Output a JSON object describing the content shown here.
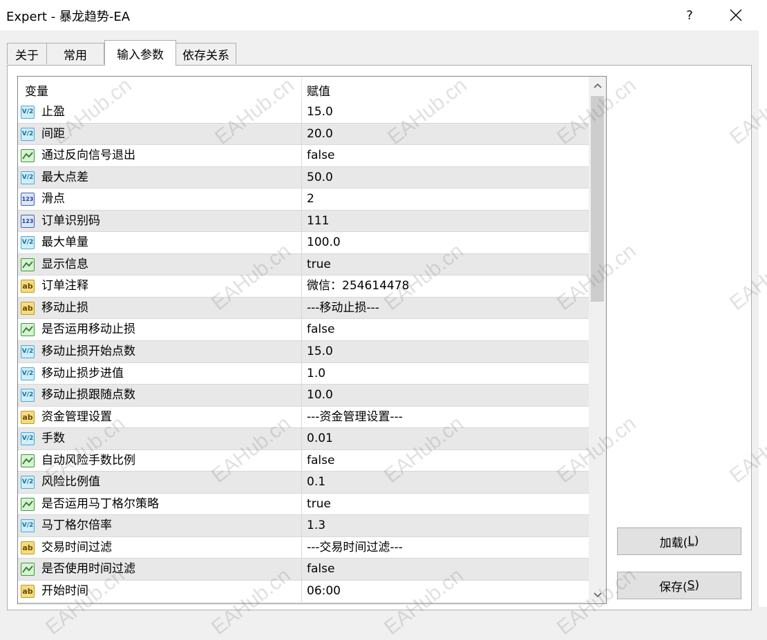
{
  "window": {
    "title": "Expert - 暴龙趋势-EA",
    "help_label": "?"
  },
  "tabs": [
    {
      "label": "关于"
    },
    {
      "label": "常用"
    },
    {
      "label": "输入参数"
    },
    {
      "label": "依存关系"
    }
  ],
  "active_tab": "输入参数",
  "grid": {
    "headers": {
      "variable": "变量",
      "value": "赋值"
    },
    "rows": [
      {
        "icon": "double",
        "name": "止盈",
        "value": "15.0"
      },
      {
        "icon": "double",
        "name": "间距",
        "value": "20.0"
      },
      {
        "icon": "bool",
        "name": "通过反向信号退出",
        "value": "false"
      },
      {
        "icon": "double",
        "name": "最大点差",
        "value": "50.0"
      },
      {
        "icon": "int",
        "name": "滑点",
        "value": "2"
      },
      {
        "icon": "int",
        "name": "订单识别码",
        "value": "111"
      },
      {
        "icon": "double",
        "name": "最大单量",
        "value": "100.0"
      },
      {
        "icon": "bool",
        "name": "显示信息",
        "value": "true"
      },
      {
        "icon": "string",
        "name": "订单注释",
        "value": "微信：254614478"
      },
      {
        "icon": "string",
        "name": "移动止损",
        "value": "---移动止损---"
      },
      {
        "icon": "bool",
        "name": "是否运用移动止损",
        "value": "false"
      },
      {
        "icon": "double",
        "name": "移动止损开始点数",
        "value": "15.0"
      },
      {
        "icon": "double",
        "name": "移动止损步进值",
        "value": "1.0"
      },
      {
        "icon": "double",
        "name": "移动止损跟随点数",
        "value": "10.0"
      },
      {
        "icon": "string",
        "name": "资金管理设置",
        "value": "---资金管理设置---"
      },
      {
        "icon": "double",
        "name": "手数",
        "value": "0.01"
      },
      {
        "icon": "bool",
        "name": "自动风险手数比例",
        "value": "false"
      },
      {
        "icon": "double",
        "name": "风险比例值",
        "value": "0.1"
      },
      {
        "icon": "bool",
        "name": "是否运用马丁格尔策略",
        "value": "true"
      },
      {
        "icon": "double",
        "name": "马丁格尔倍率",
        "value": "1.3"
      },
      {
        "icon": "string",
        "name": "交易时间过滤",
        "value": "---交易时间过滤---"
      },
      {
        "icon": "bool",
        "name": "是否使用时间过滤",
        "value": "false"
      },
      {
        "icon": "string",
        "name": "开始时间",
        "value": "06:00"
      }
    ]
  },
  "icon_glyphs": {
    "double": "V/2",
    "int": "123",
    "string": "ab"
  },
  "buttons": {
    "load": {
      "text": "加载(",
      "key": "L",
      "end": ")"
    },
    "save": {
      "text": "保存(",
      "key": "S",
      "end": ")"
    }
  },
  "watermark": "EAHub.cn"
}
